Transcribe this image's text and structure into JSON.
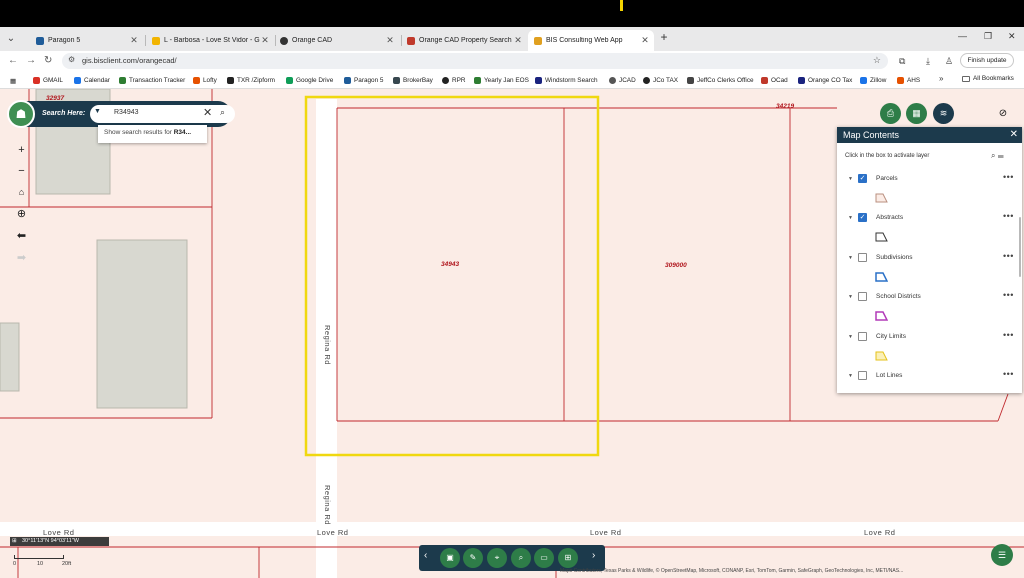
{
  "tabs": [
    {
      "label": "Paragon 5",
      "color": "#1f5c99",
      "active": false
    },
    {
      "label": "L - Barbosa - Love St Vidor - Go",
      "color": "#f2b400",
      "active": false
    },
    {
      "label": "Orange CAD",
      "color": "#333333",
      "active": false
    },
    {
      "label": "Orange CAD Property Search",
      "color": "#c0392b",
      "active": false
    },
    {
      "label": "BIS Consulting Web App",
      "color": "#e0a020",
      "active": true
    }
  ],
  "address": {
    "url": "gis.bisclient.com/orangecad/"
  },
  "finish_update": "Finish update",
  "bookmarks": [
    {
      "label": "GMAIL",
      "color": "#d93025"
    },
    {
      "label": "Calendar",
      "color": "#1a73e8"
    },
    {
      "label": "Transaction Tracker",
      "color": "#2e7d32"
    },
    {
      "label": "Lofty",
      "color": "#e65100"
    },
    {
      "label": "TXR /Zipform",
      "color": "#222222"
    },
    {
      "label": "Google Drive",
      "color": "#0f9d58"
    },
    {
      "label": "Paragon 5",
      "color": "#1f5c99"
    },
    {
      "label": "BrokerBay",
      "color": "#37474f"
    },
    {
      "label": "RPR",
      "color": "#222222"
    },
    {
      "label": "Yearly Jan EOS",
      "color": "#2e7d32"
    },
    {
      "label": "Windstorm Search",
      "color": "#1a237e"
    },
    {
      "label": "JCAD",
      "color": "#555555"
    },
    {
      "label": "JCo TAX",
      "color": "#222222"
    },
    {
      "label": "JeffCo Clerks Office",
      "color": "#444444"
    },
    {
      "label": "OCad",
      "color": "#c0392b"
    },
    {
      "label": "Orange CO Tax",
      "color": "#1a237e"
    },
    {
      "label": "Zillow",
      "color": "#1a73e8"
    },
    {
      "label": "AHS",
      "color": "#e65100"
    }
  ],
  "all_bookmarks": "All Bookmarks",
  "search": {
    "label": "Search Here:",
    "value": "R34943",
    "suggestion_prefix": "Show search results for ",
    "suggestion_term": "R34..."
  },
  "map": {
    "parcels": [
      "32937",
      "34219",
      "34943",
      "309000"
    ],
    "roads": {
      "regina1": "Regina Rd",
      "regina2": "Regina Rd",
      "love": "Love Rd"
    }
  },
  "panel": {
    "title": "Map Contents",
    "hint": "Click in the box to activate layer",
    "layers": [
      {
        "name": "Parcels",
        "checked": true,
        "color": "#b98f7f"
      },
      {
        "name": "Abstracts",
        "checked": true,
        "color": "#333333"
      },
      {
        "name": "Subdivisions",
        "checked": false,
        "color": "#2a70c7"
      },
      {
        "name": "School Districts",
        "checked": false,
        "color": "#b23ab8"
      },
      {
        "name": "City Limits",
        "checked": false,
        "color": "#e4c21a"
      },
      {
        "name": "Lot Lines",
        "checked": false,
        "color": "#333333"
      }
    ]
  },
  "coords": "30°11'13\"N 94°03'11\"W",
  "scale": {
    "l0": "0",
    "l1": "10",
    "l2": "20ft"
  },
  "attribution": "Maps Contributors, Texas Parks & Wildlife, © OpenStreetMap, Microsoft, CONANP, Esri, TomTom, Garmin, SafeGraph, GeoTechnologies, Inc, METI/NAS..."
}
